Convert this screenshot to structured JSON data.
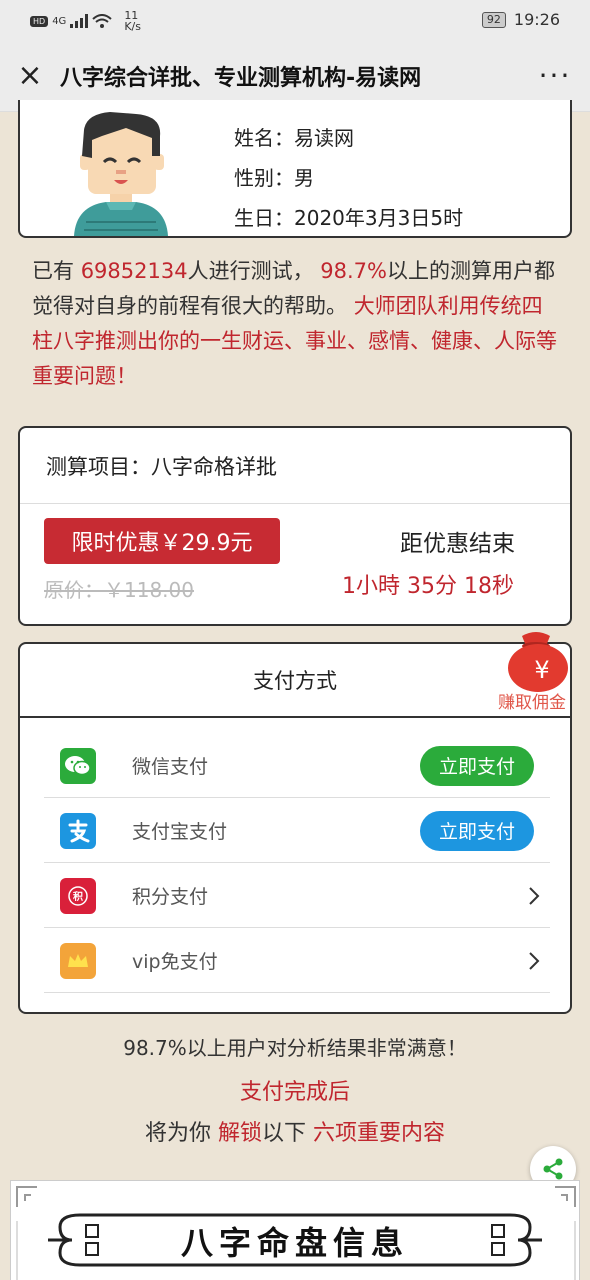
{
  "status_bar": {
    "hd": "HD",
    "signal": "4G",
    "speed_value": "11",
    "speed_unit": "K/s",
    "battery": "92",
    "time": "19:26"
  },
  "titlebar": {
    "title": "八字综合详批、专业测算机构-易读网",
    "close": "×",
    "more": "···"
  },
  "profile": {
    "name": "姓名：易读网",
    "gender": "性别：男",
    "birth": "生日：2020年3月3日5时"
  },
  "intro": {
    "p1": "已有",
    "count": "69852134",
    "p2": "人进行测试，",
    "percent": "98.7%",
    "p3": "以上的测算用户都觉得对自身的前程有很大的帮助。",
    "p4": "大师团队利用传统四柱八字推测出你的一生财运、事业、感情、健康、人际等重要问题！"
  },
  "order": {
    "project": "测算项目：八字命格详批",
    "promo": "限时优惠￥29.9元",
    "original": "原价：￥118.00",
    "countdown_label": "距优惠结束",
    "countdown": "1小時 35分 18秒"
  },
  "bonus": {
    "label": "赚取佣金",
    "symbol": "¥"
  },
  "payment": {
    "title": "支付方式",
    "methods": [
      {
        "label": "微信支付",
        "button": "立即支付",
        "color": "#2bab3b"
      },
      {
        "label": "支付宝支付",
        "button": "立即支付",
        "color": "#1d96e0"
      },
      {
        "label": "积分支付",
        "button": "",
        "color": "#d9203a"
      },
      {
        "label": "vip免支付",
        "button": "",
        "color": "#f3a43a"
      }
    ]
  },
  "footer": {
    "satisfy": "98.7%以上用户对分析结果非常满意！",
    "paydone": "支付完成后",
    "unlock_a": "将为你",
    "unlock_b": "解锁",
    "unlock_c": "以下",
    "unlock_d": "六项重要内容",
    "banner": "八字命盘信息"
  }
}
